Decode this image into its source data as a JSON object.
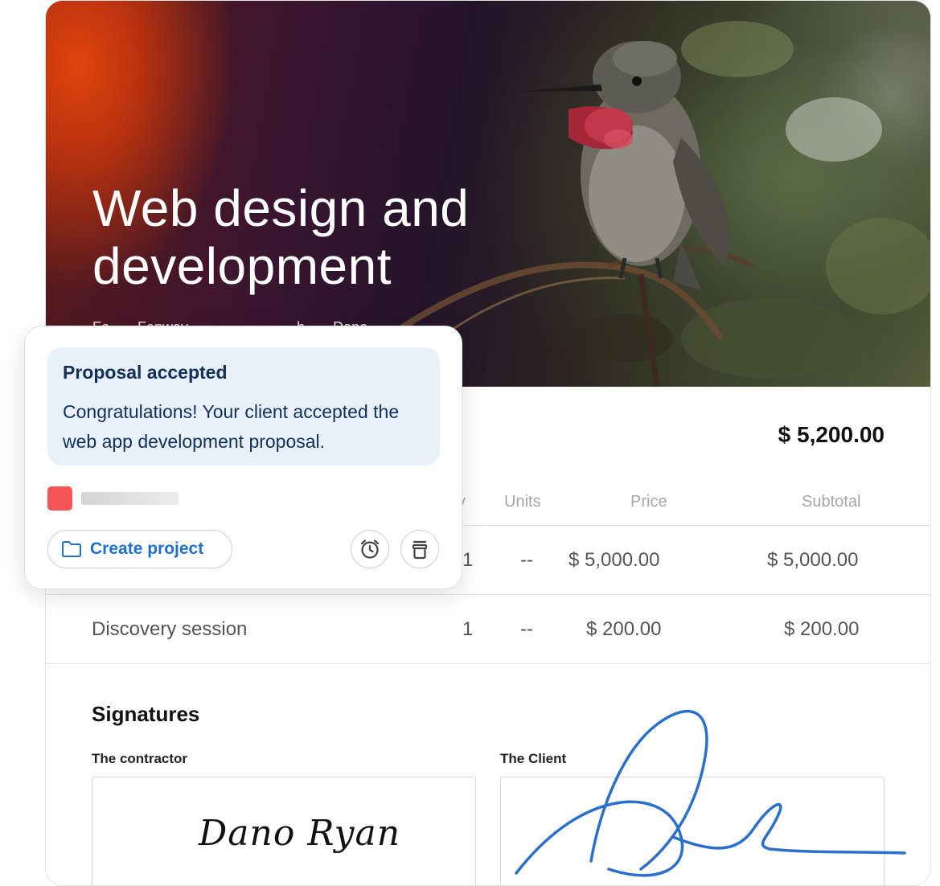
{
  "hero": {
    "title": "Web design and development",
    "meta_for": "Fo",
    "meta_client": "Fenway",
    "meta_by": "b",
    "meta_author": "Dano"
  },
  "proposal": {
    "total": "$ 5,200.00",
    "columns": [
      "y",
      "Units",
      "Price",
      "Subtotal"
    ],
    "rows": [
      {
        "name": "",
        "qty": "1",
        "units": "--",
        "price": "$ 5,000.00",
        "subtotal": "$ 5,000.00"
      },
      {
        "name": "Discovery session",
        "qty": "1",
        "units": "--",
        "price": "$ 200.00",
        "subtotal": "$ 200.00"
      }
    ]
  },
  "signatures": {
    "title": "Signatures",
    "contractor_label": "The contractor",
    "contractor_signature": "Dano Ryan",
    "client_label": "The Client"
  },
  "notification": {
    "title": "Proposal accepted",
    "body": "Congratulations! Your client accepted the web app development proposal.",
    "create_project_label": "Create project",
    "accent_color": "#f55555",
    "link_color": "#1f6fd1",
    "alert_bg": "#e8f0fa"
  },
  "icons": [
    "folder-icon",
    "alarm-clock-icon",
    "trash-icon"
  ]
}
